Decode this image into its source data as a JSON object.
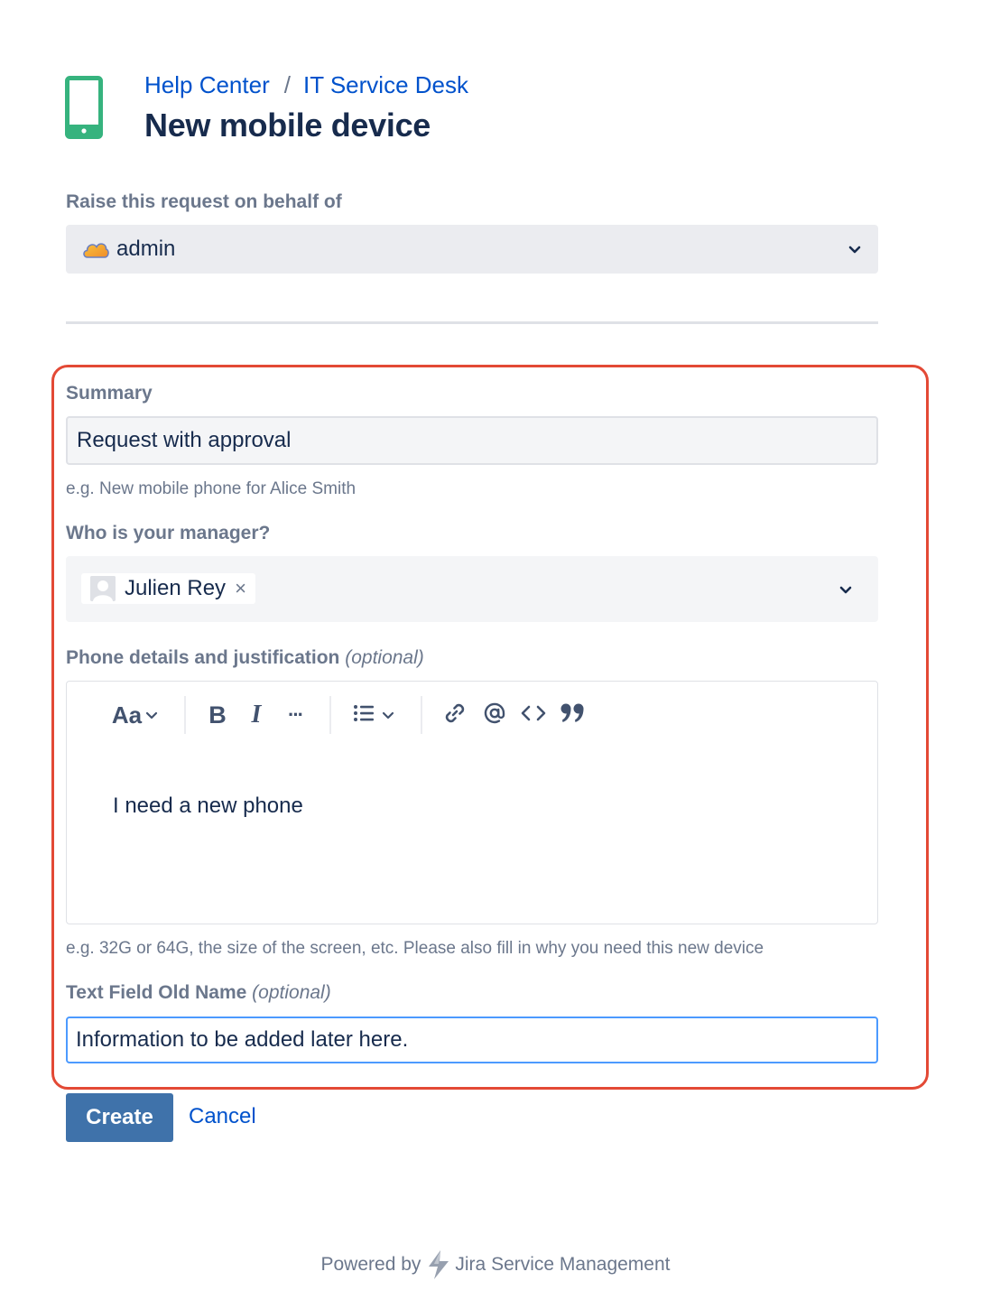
{
  "header": {
    "breadcrumb": [
      {
        "label": "Help Center"
      },
      {
        "label": "IT Service Desk"
      }
    ],
    "separator": "/",
    "title": "New mobile device",
    "icon": "mobile-phone-icon",
    "icon_color": "#36b37e"
  },
  "on_behalf": {
    "label": "Raise this request on behalf of",
    "value": "admin",
    "avatar_icon": "cloud-avatar-icon"
  },
  "summary": {
    "label": "Summary",
    "value": "Request with approval",
    "helper": "e.g. New mobile phone for Alice Smith"
  },
  "manager": {
    "label": "Who is your manager?",
    "selected": "Julien Rey",
    "remove_glyph": "×"
  },
  "details": {
    "label": "Phone details and justification",
    "optional": "(optional)",
    "toolbar": {
      "text_style": "Aa",
      "bold": "B",
      "italic": "I",
      "more": "···",
      "icons": [
        "text-style-icon",
        "bold-icon",
        "italic-icon",
        "more-icon",
        "list-icon",
        "link-icon",
        "mention-icon",
        "code-icon",
        "quote-icon"
      ]
    },
    "content": "I need a new phone",
    "helper": "e.g. 32G or 64G, the size of the screen, etc. Please also fill in why you need this new device"
  },
  "old_name": {
    "label": "Text Field Old Name",
    "optional": "(optional)",
    "value": "Information to be added later here."
  },
  "actions": {
    "create": "Create",
    "cancel": "Cancel"
  },
  "footer": {
    "powered_by": "Powered by",
    "product": "Jira Service Management"
  },
  "colors": {
    "link": "#0052cc",
    "primary_button": "#3f72aa",
    "highlight_border": "#e34935",
    "focus_border": "#4c9aff"
  }
}
